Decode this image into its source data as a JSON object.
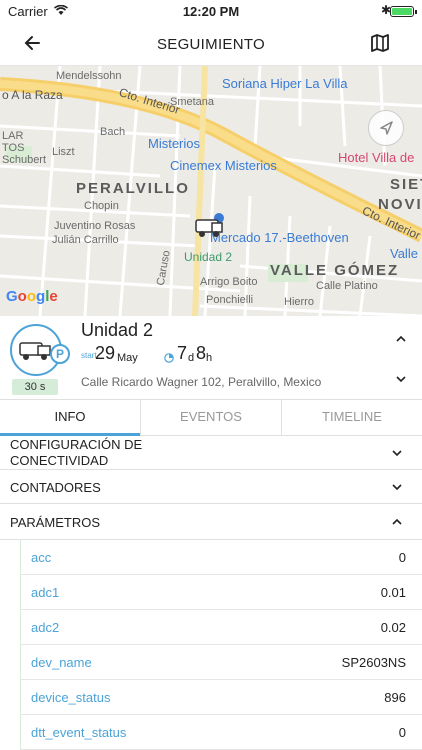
{
  "status_bar": {
    "carrier": "Carrier",
    "time": "12:20 PM"
  },
  "nav": {
    "title": "SEGUIMIENTO"
  },
  "map": {
    "labels": {
      "a_la_raza": "o A la Raza",
      "mendelssohn": "Mendelssohn",
      "cto_interior": "Cto. Interior",
      "smetana": "Smetana",
      "soriana": "Soriana Hiper La Villa",
      "misterios": "Misterios",
      "cinemex": "Cinemex Misterios",
      "hotel": "Hotel Villa de",
      "peralvillo": "PERALVILLO",
      "siete": "SIET",
      "novi": "NOVI",
      "mercado": "Mercado 17.-Beethoven",
      "unidad": "Unidad 2",
      "valle_gomez": "VALLE GÓMEZ",
      "calle_platino": "Calle Platino",
      "cto_interior_2": "Cto. Interior",
      "valle": "Valle",
      "chopin": "Chopin",
      "juventino": "Juventino Rosas",
      "julian": "Julián Carrillo",
      "lar": "LAR",
      "tos": "TOS",
      "schubert": "Schubert",
      "liszt": "Liszt",
      "bach": "Bach",
      "caruso": "Caruso",
      "arrigo": "Arrigo Boito",
      "ponchielli": "Ponchielli",
      "hierro": "Hierro",
      "google": "Google"
    }
  },
  "unit": {
    "name": "Unidad 2",
    "refresh": "30 s",
    "start_label": "start",
    "start_day": "29",
    "start_month": "May",
    "duration_days": "7",
    "duration_days_unit": "d",
    "duration_hours": "8",
    "duration_hours_unit": "h",
    "address": "Calle Ricardo Wagner 102, Peralvillo, Mexico",
    "parking_letter": "P"
  },
  "tabs": [
    {
      "label": "INFO",
      "active": true
    },
    {
      "label": "EVENTOS",
      "active": false
    },
    {
      "label": "TIMELINE",
      "active": false
    }
  ],
  "sections": {
    "config": "CONFIGURACIÓN DE\nCONECTIVIDAD",
    "config_line1": "CONFIGURACIÓN DE",
    "config_line2": "CONECTIVIDAD",
    "counters": "CONTADORES",
    "params": "PARÁMETROS"
  },
  "params": [
    {
      "key": "acc",
      "value": "0"
    },
    {
      "key": "adc1",
      "value": "0.01"
    },
    {
      "key": "adc2",
      "value": "0.02"
    },
    {
      "key": "dev_name",
      "value": "SP2603NS"
    },
    {
      "key": "device_status",
      "value": "896"
    },
    {
      "key": "dtt_event_status",
      "value": "0"
    }
  ],
  "colors": {
    "accent": "#4ba3d8",
    "refresh_bg": "#d5ecd9"
  }
}
